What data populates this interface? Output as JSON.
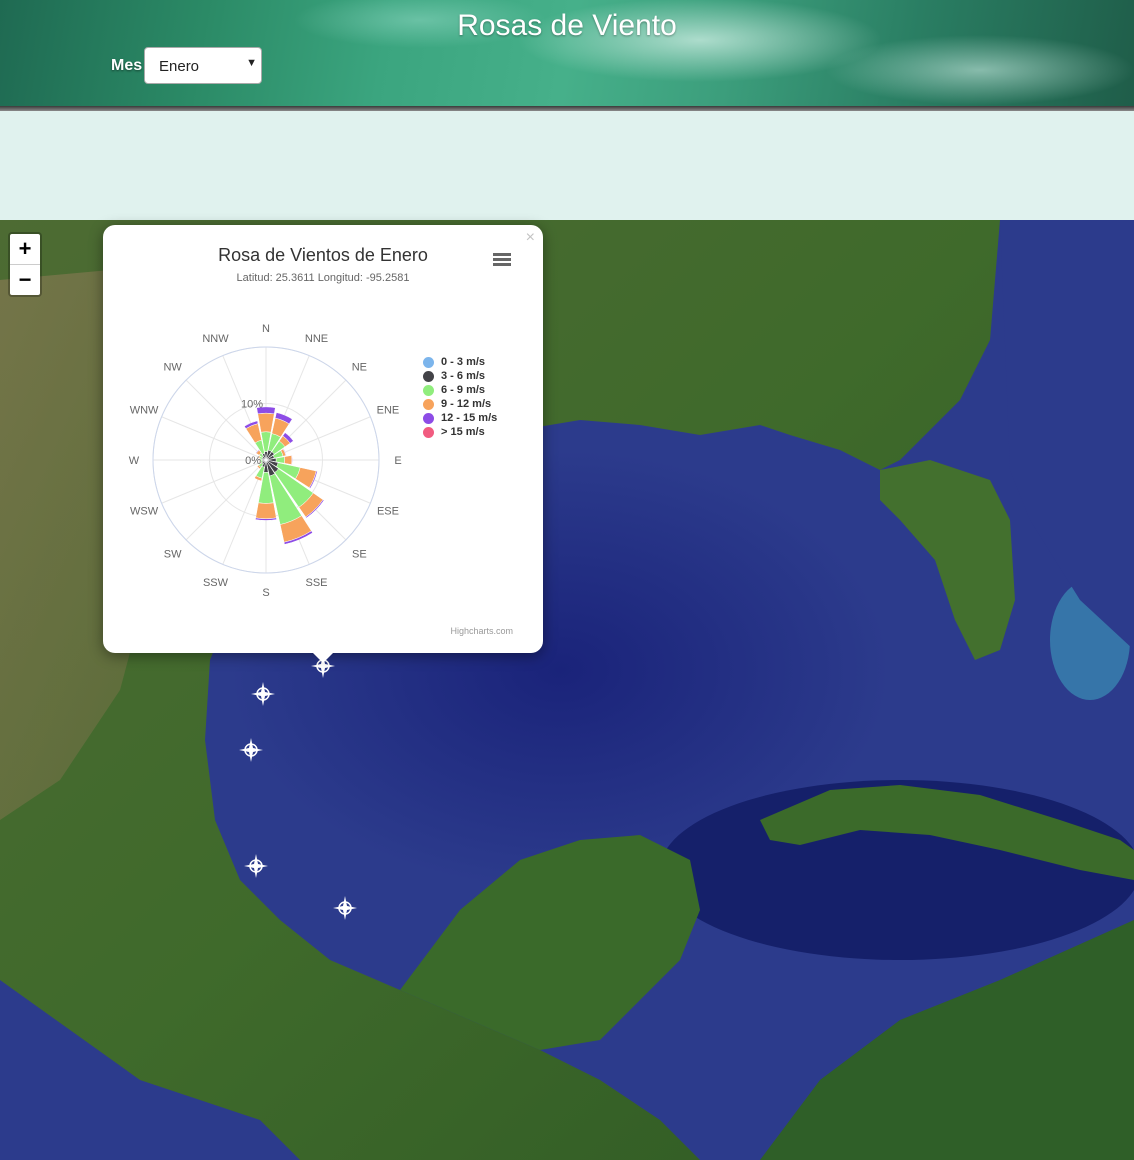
{
  "header": {
    "title": "Rosas de Viento",
    "month_label": "Mes",
    "month_select": {
      "value": "Enero"
    }
  },
  "map": {
    "zoom_in": "+",
    "zoom_out": "−",
    "colors": {
      "ocean": "#2c3b8c",
      "land": "#3d6b2a"
    }
  },
  "popup": {
    "close_label": "×",
    "chart_data": {
      "type": "windrose",
      "title": "Rosa de Vientos de Enero",
      "subtitle": "Latitud: 25.3611 Longitud: -95.2581",
      "directions": [
        "N",
        "NNE",
        "NE",
        "ENE",
        "E",
        "ESE",
        "SE",
        "SSE",
        "S",
        "SSW",
        "SW",
        "WSW",
        "W",
        "WNW",
        "NW",
        "NNW"
      ],
      "direction_labels": [
        "N",
        "NNE",
        "NE",
        "ENE",
        "E",
        "ESE",
        "SE",
        "SSE",
        "S",
        "SSW",
        "SW",
        "WSW",
        "W",
        "WNW",
        "NW",
        "NNW"
      ],
      "stacking": "normal",
      "radial_axis": {
        "max": 20,
        "tick_labels": [
          "0%",
          "10%"
        ]
      },
      "grid": true,
      "legend_position": "right",
      "series": [
        {
          "name": "0 - 3 m/s",
          "color": "#7cb5ec",
          "values": [
            0.3,
            0.3,
            0.3,
            0.3,
            0.3,
            0.3,
            0.3,
            0.3,
            0.3,
            0.3,
            0.3,
            0.3,
            0.3,
            0.3,
            0.3,
            0.3
          ]
        },
        {
          "name": "3 - 6 m/s",
          "color": "#434348",
          "values": [
            1.2,
            1.5,
            1.5,
            1.2,
            1.5,
            1.9,
            2.4,
            2.6,
            1.9,
            1.0,
            0.6,
            0.4,
            0.4,
            0.4,
            0.5,
            0.9
          ]
        },
        {
          "name": "6 - 9 m/s",
          "color": "#90ed7d",
          "values": [
            3.5,
            3.0,
            2.3,
            1.6,
            1.5,
            4.0,
            7.5,
            8.8,
            5.5,
            2.0,
            0.7,
            0.3,
            0.4,
            0.5,
            0.7,
            2.4
          ]
        },
        {
          "name": "9 - 12 m/s",
          "color": "#f7a35c",
          "values": [
            3.3,
            2.8,
            1.1,
            0.5,
            1.3,
            2.9,
            2.1,
            3.2,
            2.7,
            0.5,
            0.3,
            0.2,
            0.1,
            0.2,
            0.6,
            3.0
          ]
        },
        {
          "name": "12 - 15 m/s",
          "color": "#8d4ce6",
          "values": [
            1.1,
            1.0,
            0.7,
            0.1,
            0.1,
            0.2,
            0.2,
            0.4,
            0.3,
            0.0,
            0.0,
            0.0,
            0.0,
            0.0,
            0.1,
            0.5
          ]
        },
        {
          "name": "> 15 m/s",
          "color": "#f15c80",
          "values": [
            0.0,
            0.0,
            0.0,
            0.0,
            0.0,
            0.0,
            0.0,
            0.0,
            0.0,
            0.0,
            0.0,
            0.0,
            0.0,
            0.0,
            0.0,
            0.0
          ]
        }
      ]
    },
    "menu_icon": "hamburger-menu-icon",
    "credits": "Highcharts.com"
  },
  "markers": {
    "icon": "compass-star-icon",
    "count": 5
  }
}
